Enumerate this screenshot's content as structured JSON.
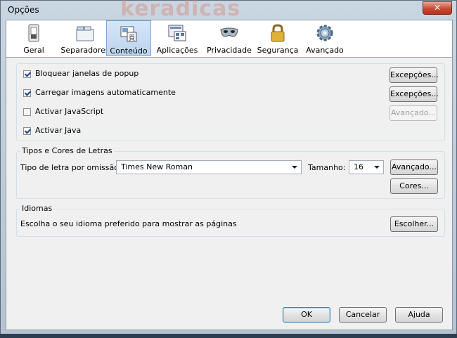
{
  "window": {
    "title": "Opções",
    "watermark": "keradicas",
    "close_glyph": "✕"
  },
  "toolbar": {
    "tabs": [
      {
        "label": "Geral",
        "icon": "switch-icon"
      },
      {
        "label": "Separadores",
        "icon": "tabs-icon"
      },
      {
        "label": "Conteúdo",
        "icon": "content-icon",
        "active": true
      },
      {
        "label": "Aplicações",
        "icon": "applications-icon"
      },
      {
        "label": "Privacidade",
        "icon": "mask-icon"
      },
      {
        "label": "Segurança",
        "icon": "lock-icon"
      },
      {
        "label": "Avançado",
        "icon": "gear-icon"
      }
    ]
  },
  "content": {
    "popup": {
      "label": "Bloquear janelas de popup",
      "checked": true,
      "button": "Excepções..."
    },
    "images": {
      "label": "Carregar imagens automaticamente",
      "checked": true,
      "button": "Excepções..."
    },
    "javascript": {
      "label": "Activar JavaScript",
      "checked": false,
      "button": "Avançado..."
    },
    "java": {
      "label": "Activar Java",
      "checked": true
    }
  },
  "fonts": {
    "title": "Tipos e Cores de Letras",
    "default_label": "Tipo de letra por omissão:",
    "default_value": "Times New Roman",
    "size_label": "Tamanho:",
    "size_value": "16",
    "advanced_button": "Avançado...",
    "colors_button": "Cores..."
  },
  "languages": {
    "title": "Idiomas",
    "description": "Escolha o seu idioma preferido para mostrar as páginas",
    "choose_button": "Escolher..."
  },
  "footer": {
    "ok": "OK",
    "cancel": "Cancelar",
    "help": "Ajuda"
  },
  "colors": {
    "accent": "#7ea9d4",
    "checkmark": "#1c3f94"
  }
}
